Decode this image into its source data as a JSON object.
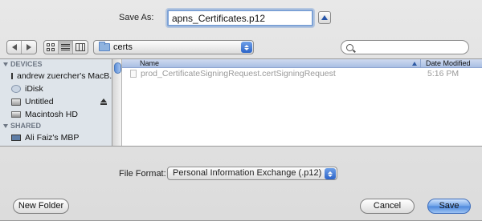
{
  "dialog": {
    "save_as_label": "Save As:",
    "filename": "apns_Certificates.p12",
    "expand_button": "expand-arrow"
  },
  "toolbar": {
    "path": "certs",
    "search_placeholder": ""
  },
  "sidebar": {
    "devices_header": "DEVICES",
    "devices": [
      {
        "label": "andrew zuercher's MacB...",
        "icon": "computer-icon"
      },
      {
        "label": "iDisk",
        "icon": "idisk-icon"
      },
      {
        "label": "Untitled",
        "icon": "drive-icon",
        "ejectable": true
      },
      {
        "label": "Macintosh HD",
        "icon": "harddisk-icon"
      }
    ],
    "shared_header": "SHARED",
    "shared": [
      {
        "label": "Ali Faiz's MBP",
        "icon": "computer-icon"
      }
    ]
  },
  "filelist": {
    "columns": {
      "name": "Name",
      "date": "Date Modified"
    },
    "files": [
      {
        "name": "prod_CertificateSigningRequest.certSigningRequest",
        "date": "5:16 PM"
      }
    ]
  },
  "format": {
    "label": "File Format:",
    "selected": "Personal Information Exchange (.p12)"
  },
  "buttons": {
    "new_folder": "New Folder",
    "cancel": "Cancel",
    "save": "Save"
  },
  "colors": {
    "accent": "#4b87dc",
    "sidebar_bg": "#dee4ea",
    "header_bg": "#a9bfe3"
  }
}
